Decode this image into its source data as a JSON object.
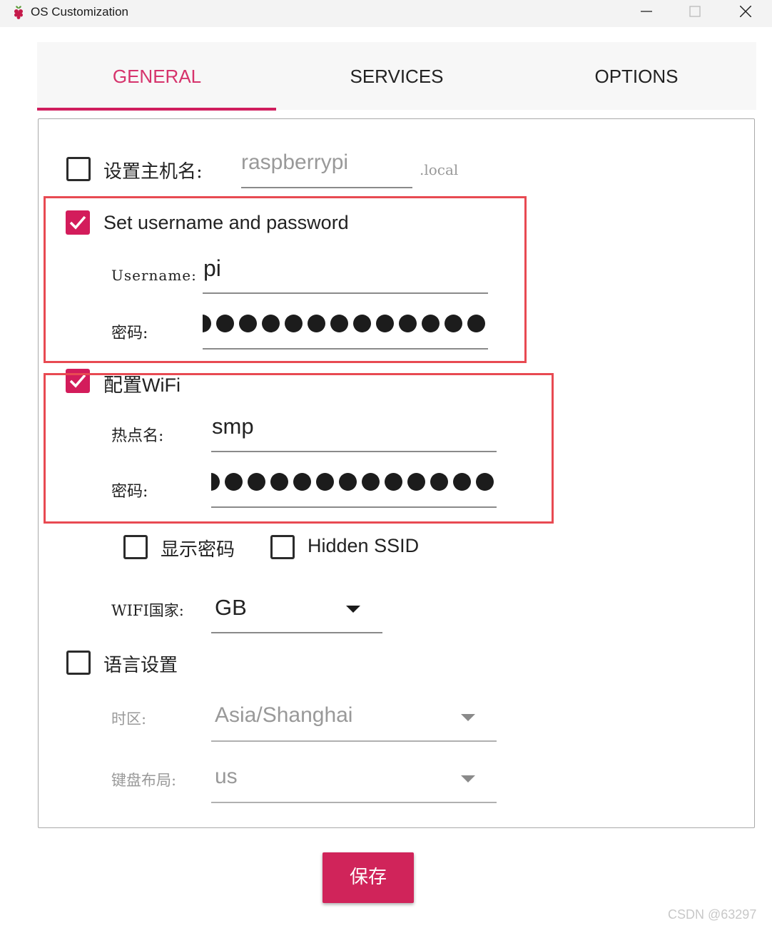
{
  "window": {
    "title": "OS Customization"
  },
  "tabs": [
    {
      "label": "GENERAL",
      "active": true
    },
    {
      "label": "SERVICES",
      "active": false
    },
    {
      "label": "OPTIONS",
      "active": false
    }
  ],
  "hostname": {
    "label": "设置主机名:",
    "checked": false,
    "value": "raspberrypi",
    "suffix": ".local"
  },
  "user": {
    "label": "Set username and password",
    "checked": true,
    "username_label": "Username:",
    "username_value": "pi",
    "password_label": "密码:"
  },
  "wifi": {
    "label": "配置WiFi",
    "checked": true,
    "ssid_label": "热点名:",
    "ssid_value": "smp",
    "password_label": "密码:",
    "show_password_label": "显示密码",
    "show_password_checked": false,
    "hidden_ssid_label": "Hidden SSID",
    "hidden_ssid_checked": false,
    "country_label": "WIFI国家:",
    "country_value": "GB"
  },
  "locale": {
    "label": "语言设置",
    "checked": false,
    "timezone_label": "时区:",
    "timezone_value": "Asia/Shanghai",
    "keyboard_label": "键盘布局:",
    "keyboard_value": "us"
  },
  "save_label": "保存",
  "watermark": "CSDN @63297",
  "colors": {
    "accent": "#d31c5b",
    "highlight_box": "#e84a52"
  }
}
